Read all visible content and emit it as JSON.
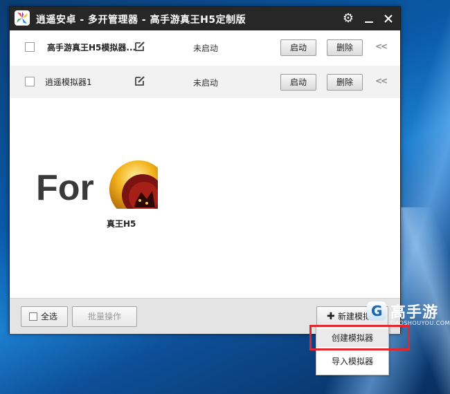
{
  "window": {
    "title": "逍遥安卓 - 多开管理器 - 高手游真王H5定制版"
  },
  "rows": [
    {
      "name": "高手游真王H5模拟器...",
      "status": "未启动",
      "start_label": "启动",
      "delete_label": "删除",
      "expand": "<<"
    },
    {
      "name": "逍遥模拟器1",
      "status": "未启动",
      "start_label": "启动",
      "delete_label": "删除",
      "expand": "<<"
    }
  ],
  "banner": {
    "for_text": "For",
    "game_label": "真王H5"
  },
  "footer": {
    "select_all_label": "全选",
    "batch_label": "批量操作",
    "new_emulator_label": "新建模拟器"
  },
  "menu": {
    "items": [
      "创建模拟器",
      "导入模拟器"
    ]
  },
  "watermark": {
    "name": "高手游",
    "sub": "GAOSHOUYOU.COM",
    "logo_letter": "G"
  },
  "colors": {
    "titlebar": "#272727",
    "highlight_box": "#e2262b"
  }
}
